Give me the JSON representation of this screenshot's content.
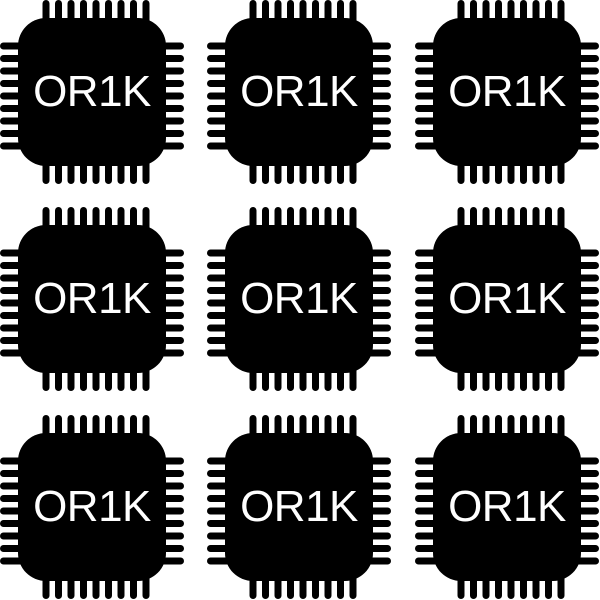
{
  "chips": [
    {
      "label": "OR1K"
    },
    {
      "label": "OR1K"
    },
    {
      "label": "OR1K"
    },
    {
      "label": "OR1K"
    },
    {
      "label": "OR1K"
    },
    {
      "label": "OR1K"
    },
    {
      "label": "OR1K"
    },
    {
      "label": "OR1K"
    },
    {
      "label": "OR1K"
    }
  ],
  "colors": {
    "chip_body": "#000000",
    "label": "#ffffff",
    "background": "#ffffff"
  },
  "icon": "microchip-icon"
}
